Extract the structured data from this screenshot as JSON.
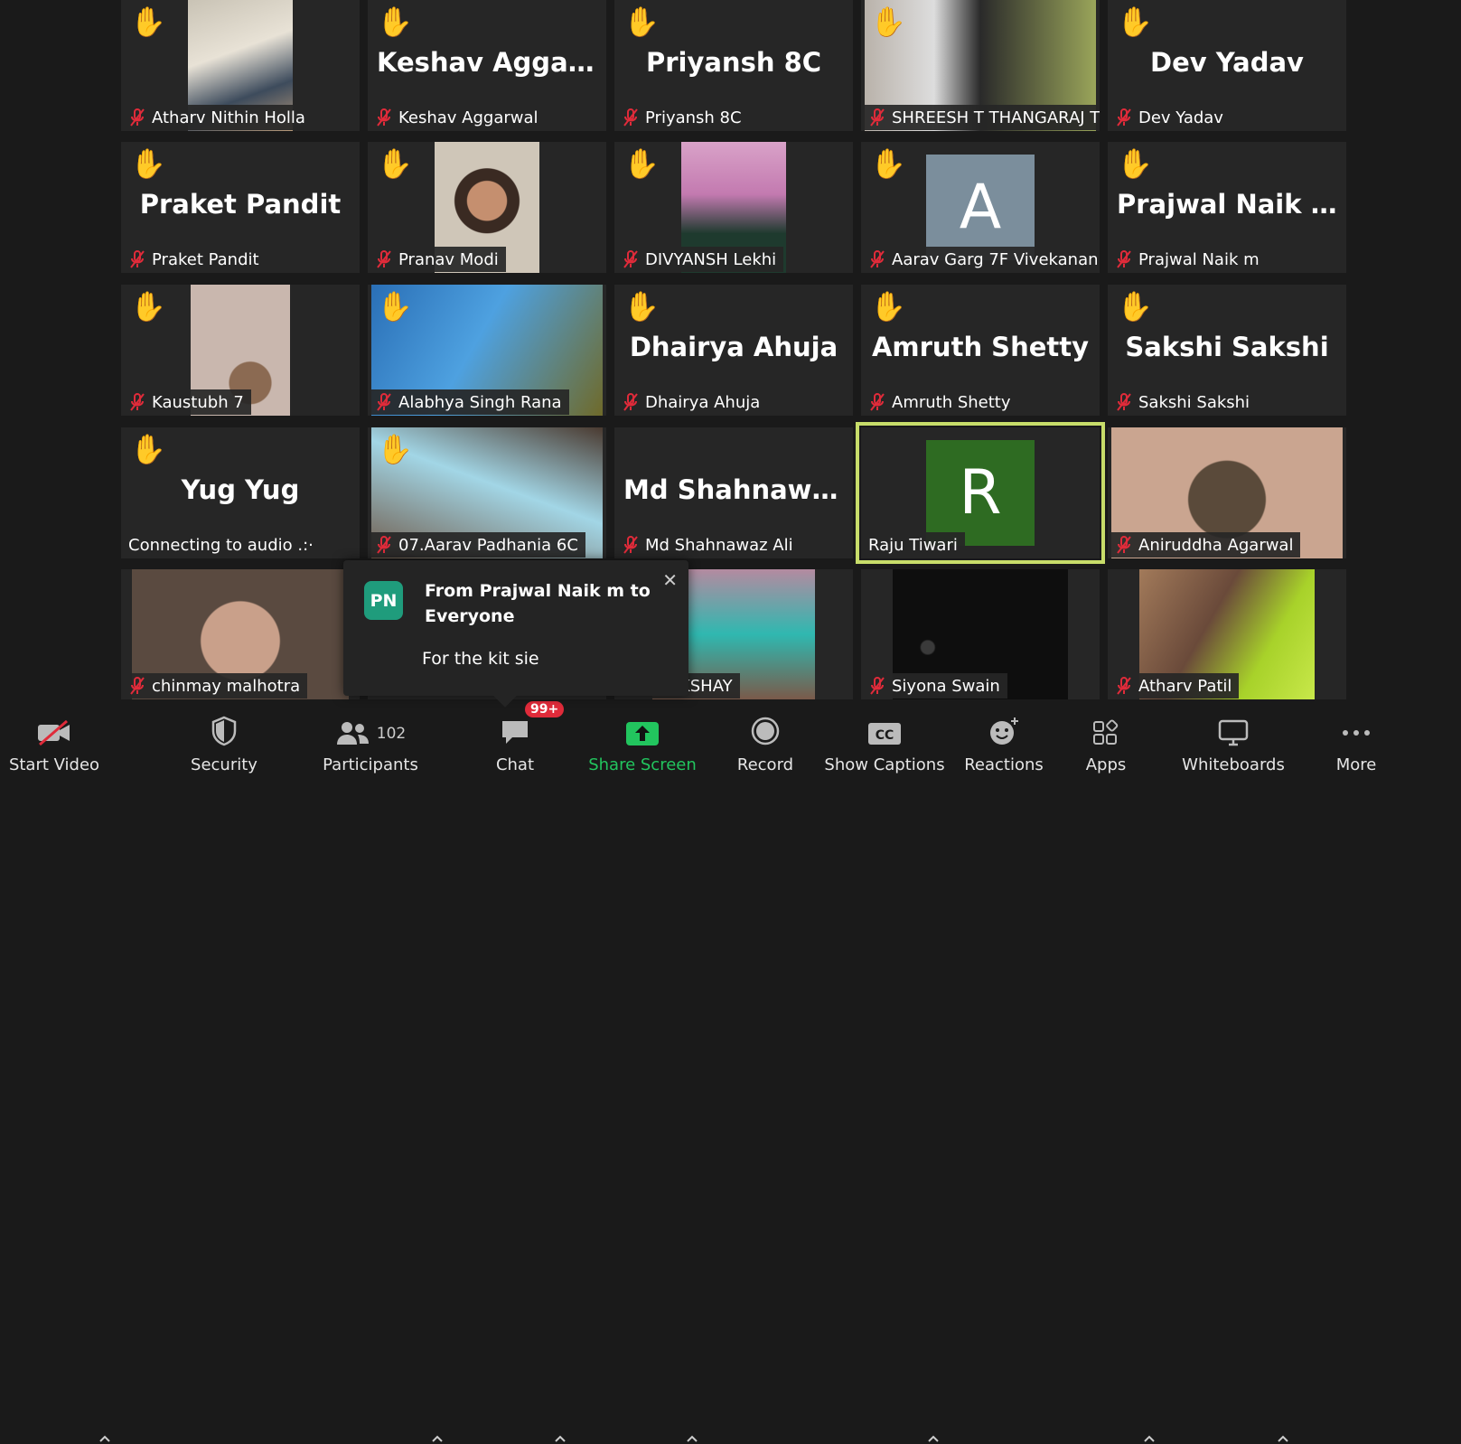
{
  "tiles": [
    {
      "name": "Atharv Nithin Holla",
      "big": "",
      "hand": true,
      "video": "photo1"
    },
    {
      "name": "Keshav Aggarwal",
      "big": "Keshav Aggarwal",
      "hand": true
    },
    {
      "name": "Priyansh 8C",
      "big": "Priyansh 8C",
      "hand": true
    },
    {
      "name": "SHREESH T THANGARAJ T",
      "big": "",
      "hand": true,
      "video": "photo2"
    },
    {
      "name": "Dev Yadav",
      "big": "Dev Yadav",
      "hand": true
    },
    {
      "name": "Praket Pandit",
      "big": "Praket Pandit",
      "hand": true
    },
    {
      "name": "Pranav Modi",
      "big": "",
      "hand": true,
      "video": "photo3"
    },
    {
      "name": "DIVYANSH Lekhi",
      "big": "",
      "hand": true,
      "video": "photo4"
    },
    {
      "name": "Aarav Garg 7F Vivekanan...",
      "big": "",
      "hand": true,
      "avatar": "A",
      "avatar_color": "#7b8e9c"
    },
    {
      "name": "Prajwal Naik m",
      "big": "Prajwal Naik m",
      "hand": true
    },
    {
      "name": "Kaustubh 7",
      "big": "",
      "hand": true,
      "video": "photo5"
    },
    {
      "name": "Alabhya Singh Rana",
      "big": "",
      "hand": true,
      "video": "photo6"
    },
    {
      "name": "Dhairya Ahuja",
      "big": "Dhairya Ahuja",
      "hand": true
    },
    {
      "name": "Amruth Shetty",
      "big": "Amruth Shetty",
      "hand": true
    },
    {
      "name": "Sakshi Sakshi",
      "big": "Sakshi Sakshi",
      "hand": true
    },
    {
      "name": "Connecting to audio .:·",
      "big": "Yug Yug",
      "hand": true,
      "nomic": true
    },
    {
      "name": "07.Aarav Padhania 6C",
      "big": "",
      "hand": true,
      "video": "photo7"
    },
    {
      "name": "Md Shahnawaz Ali",
      "big": "Md  Shahnawaz...",
      "hand": false
    },
    {
      "name": "Raju Tiwari",
      "big": "",
      "hand": false,
      "avatar": "R",
      "avatar_color": "#2e6b22",
      "speaking": true,
      "nomic": true
    },
    {
      "name": "Aniruddha Agarwal",
      "big": "",
      "hand": false,
      "video": "photo8"
    },
    {
      "name": "chinmay malhotra",
      "big": "",
      "hand": false,
      "video": "photo9"
    },
    {
      "name": "",
      "big": "",
      "hand": false
    },
    {
      "name": "HAY LAKSHAY",
      "big": "",
      "hand": false,
      "video": "photo10",
      "nomic": true
    },
    {
      "name": "Siyona Swain",
      "big": "",
      "hand": false,
      "video": "photo11"
    },
    {
      "name": "Atharv Patil",
      "big": "",
      "hand": false,
      "video": "photo12"
    }
  ],
  "chat_popup": {
    "initials": "PN",
    "from": "From Prajwal Naik m to Everyone",
    "message": "For the kit sie"
  },
  "toolbar": {
    "start_video": "Start Video",
    "security": "Security",
    "participants": "Participants",
    "participant_count": "102",
    "chat": "Chat",
    "chat_badge": "99+",
    "share_screen": "Share Screen",
    "record": "Record",
    "show_captions": "Show Captions",
    "reactions": "Reactions",
    "apps": "Apps",
    "whiteboards": "Whiteboards",
    "more": "More"
  },
  "colors": {
    "share_green": "#22c55e",
    "chat_badge": "#e02b3a",
    "speaker_outline": "#c8dd6a"
  }
}
